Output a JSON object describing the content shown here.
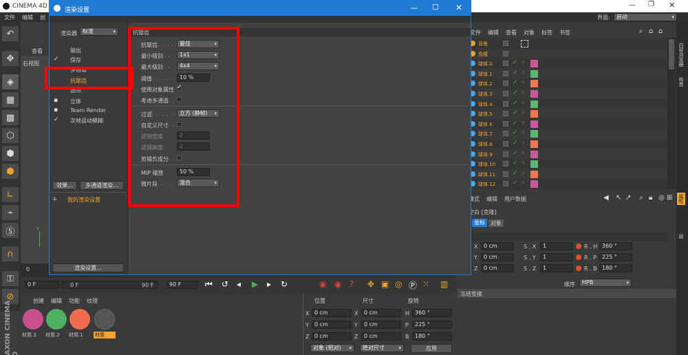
{
  "app": {
    "title": "CINEMA 4D",
    "menu": [
      "文件",
      "编辑",
      "创"
    ],
    "layout_label": "界面:",
    "layout_value": "启动",
    "viewport_tab": "查看",
    "viewport_name": "右视图",
    "brand_vertical": "MAXON CINEMA 4D"
  },
  "dialog": {
    "title": "渲染设置",
    "renderer_label": "渲染器",
    "renderer_value": "标准",
    "items": [
      {
        "label": "输出",
        "checked": false
      },
      {
        "label": "保存",
        "checked": true
      },
      {
        "label": "多通道",
        "checked": false
      },
      {
        "label": "抗锯齿",
        "checked": false,
        "selected": true
      },
      {
        "label": "选项",
        "checked": false
      },
      {
        "label": "立体",
        "checked": false
      },
      {
        "label": "Team Render",
        "checked": false
      },
      {
        "label": "次帧运动模糊",
        "checked": true
      }
    ],
    "effects_button": "效果...",
    "multipass_button": "多通道渲染...",
    "my_settings": "我的渲染设置",
    "render_settings_button": "渲染设置...",
    "section_header": "抗锯齿",
    "fields": {
      "antialias_label": "抗锯齿",
      "antialias_value": "最佳",
      "min_level_label": "最小级别",
      "min_level_value": "1x1",
      "max_level_label": "最大级别",
      "max_level_value": "4x4",
      "threshold_label": "阈值",
      "threshold_value": "10 %",
      "use_object_props_label": "使用对象属性",
      "consider_multipass_label": "考虑多通道",
      "filter_label": "过滤",
      "filter_value": "立方 (静帧)",
      "custom_size_label": "自定义尺寸",
      "filter_width_label": "滤镜宽度",
      "filter_width_value": "2",
      "filter_height_label": "滤镜高度",
      "filter_height_value": "2",
      "clip_negative_label": "剪辑负成分",
      "mip_label": "MIP 缩放",
      "mip_value": "50 %",
      "micropoly_label": "微片段",
      "micropoly_value": "混合"
    }
  },
  "objects_panel": {
    "menu": [
      "文件",
      "编辑",
      "查看",
      "对象",
      "标签",
      "书签"
    ],
    "rows": [
      "背景",
      "克隆",
      "球体.0",
      "球体.1",
      "球体.2",
      "球体.3",
      "球体.4",
      "球体.5",
      "球体.6",
      "球体.7",
      "球体.8",
      "球体.9",
      "球体.10",
      "球体.11",
      "球体.12"
    ],
    "tag_colors": [
      "#c85a9a",
      "#5cb870",
      "#f07850",
      "#c85a9a",
      "#5cb870",
      "#f07850",
      "#c85a9a",
      "#5cb870",
      "#f07850",
      "#c85a9a",
      "#5cb870",
      "#f07850",
      "#c85a9a"
    ]
  },
  "attributes_panel": {
    "menu": [
      "模式",
      "编辑",
      "用户数据"
    ],
    "object_name": "空白 [克隆]",
    "tabs": [
      "坐标",
      "对象"
    ],
    "rows": [
      {
        "p": "X",
        "pv": "0 cm",
        "s": "S . X",
        "sv": "1",
        "r": "R . H",
        "rv": "360 °"
      },
      {
        "p": "Y",
        "pv": "0 cm",
        "s": "S . Y",
        "sv": "1",
        "r": "R . P",
        "rv": "225 °"
      },
      {
        "p": "Z",
        "pv": "0 cm",
        "s": "S . Z",
        "sv": "1",
        "r": "R . B",
        "rv": "180 °"
      }
    ],
    "order_label": "顺序",
    "order_value": "HPB",
    "freeze_label": "冻结变换"
  },
  "transport": {
    "start": "0 F",
    "current": "0 F",
    "end_slider": "90 F",
    "end": "90 F",
    "ruler_zero": "0"
  },
  "materials": {
    "menu": [
      "创建",
      "编辑",
      "功能",
      "纹理"
    ],
    "items": [
      {
        "name": "材质.3",
        "color": "#c8508a"
      },
      {
        "name": "材质.2",
        "color": "#4cb060"
      },
      {
        "name": "材质.1",
        "color": "#ef6c4c"
      },
      {
        "name": "材质",
        "color": "#555555"
      }
    ]
  },
  "coords_panel": {
    "headers": [
      "位置",
      "尺寸",
      "旋转"
    ],
    "rows": [
      {
        "a": "X",
        "av": "0 cm",
        "b": "X",
        "bv": "0 cm",
        "c": "H",
        "cv": "360 °"
      },
      {
        "a": "Y",
        "av": "0 cm",
        "b": "Y",
        "bv": "0 cm",
        "c": "P",
        "cv": "225 °"
      },
      {
        "a": "Z",
        "av": "0 cm",
        "b": "Z",
        "bv": "0 cm",
        "c": "B",
        "cv": "180 °"
      }
    ],
    "mode1": "对象 (相对)",
    "mode2": "绝对尺寸",
    "apply": "应用"
  },
  "side_tabs": [
    "内容浏览器",
    "构造",
    "属性",
    "层"
  ],
  "colors": {
    "dialog_titlebar": "#1f7ad6",
    "highlight": "#ff0000",
    "accent_orange": "#f3a42a"
  }
}
